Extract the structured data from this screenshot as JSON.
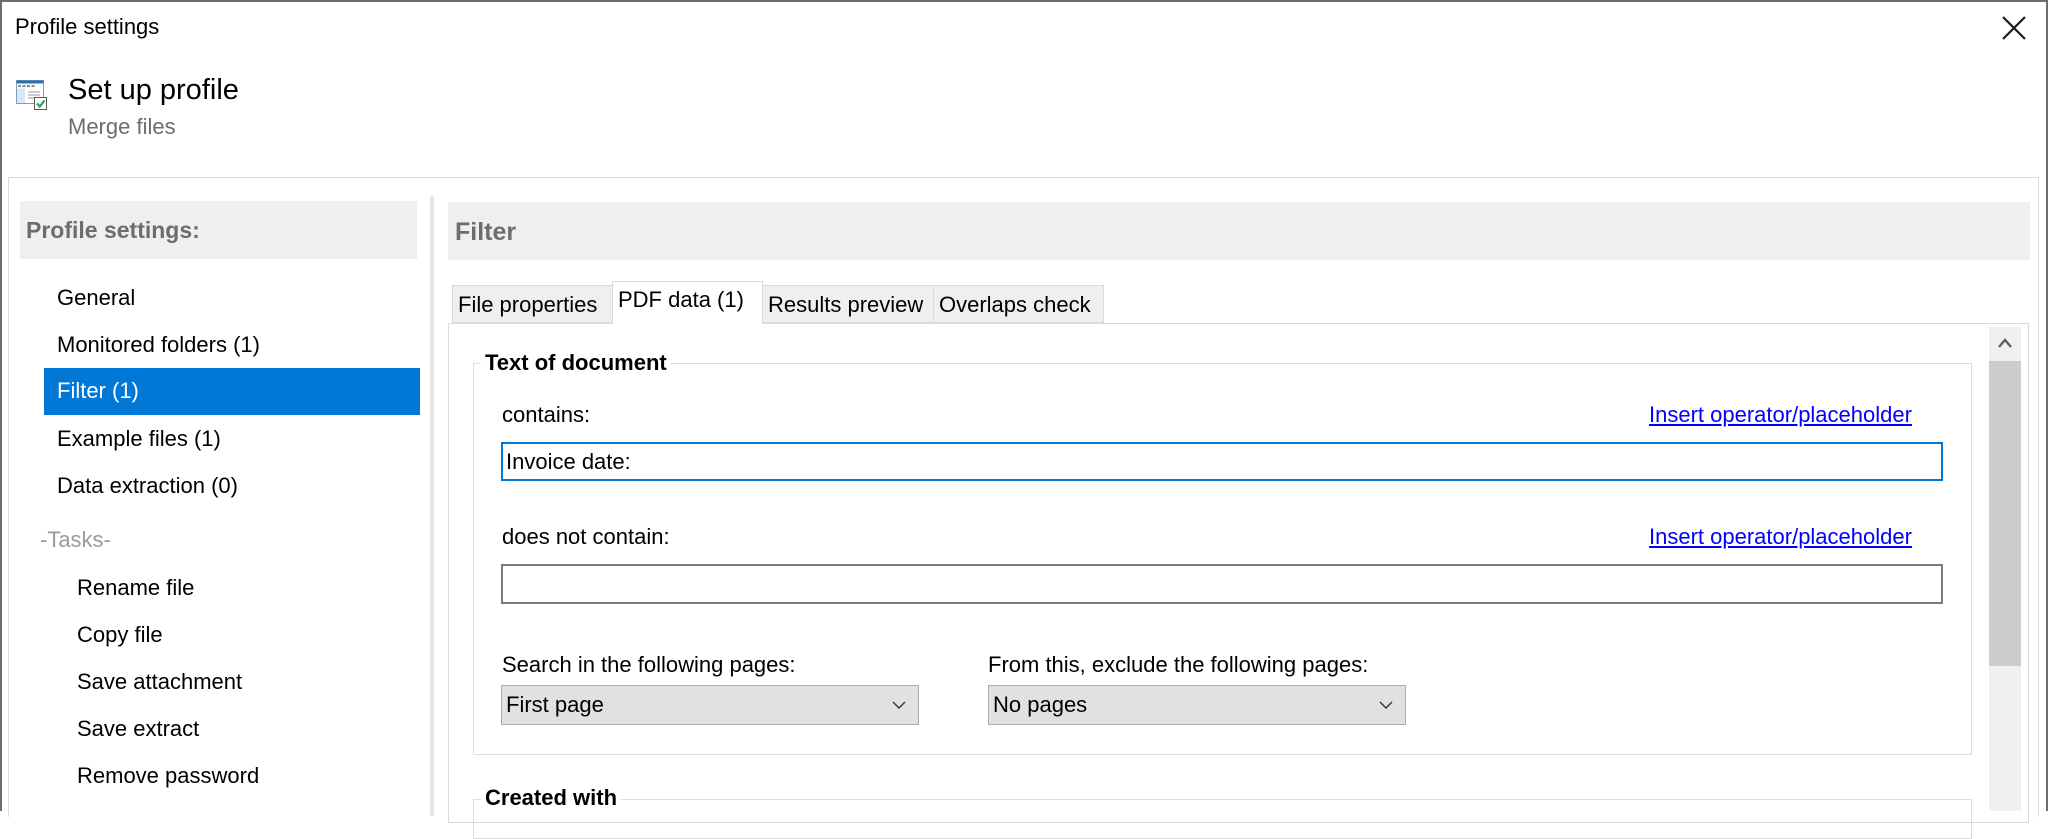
{
  "window": {
    "title": "Profile settings",
    "close_icon": "close-icon"
  },
  "header": {
    "icon": "profile-settings-icon",
    "title": "Set up profile",
    "subtitle": "Merge files"
  },
  "sidebar": {
    "header": "Profile settings:",
    "items": [
      {
        "label": "General",
        "selected": false
      },
      {
        "label": "Monitored folders (1)",
        "selected": false
      },
      {
        "label": "Filter (1)",
        "selected": true
      },
      {
        "label": "Example files (1)",
        "selected": false
      },
      {
        "label": "Data extraction (0)",
        "selected": false
      }
    ],
    "tasks_label": "-Tasks-",
    "tasks": [
      {
        "label": "Rename file"
      },
      {
        "label": "Copy file"
      },
      {
        "label": "Save attachment"
      },
      {
        "label": "Save extract"
      },
      {
        "label": "Remove password"
      }
    ],
    "selected_color": "#0078d7"
  },
  "main": {
    "title": "Filter",
    "tabs": [
      {
        "label": "File properties",
        "active": false
      },
      {
        "label": "PDF data (1)",
        "active": true
      },
      {
        "label": "Results preview",
        "active": false
      },
      {
        "label": "Overlaps check",
        "active": false
      }
    ],
    "text_of_document": {
      "title": "Text of document",
      "contains_label": "contains:",
      "contains_value": "Invoice date:",
      "contains_link": "Insert operator/placeholder",
      "not_contains_label": "does not contain:",
      "not_contains_value": "",
      "not_contains_link": "Insert operator/placeholder",
      "search_pages_label": "Search in the following pages:",
      "search_pages_value": "First page",
      "exclude_pages_label": "From this, exclude the following pages:",
      "exclude_pages_value": "No pages"
    },
    "created_with": {
      "title": "Created with"
    }
  },
  "colors": {
    "accent": "#0078d7",
    "link": "#0000ff",
    "header_bg": "#efefef",
    "header_text": "#6d6d6d"
  }
}
